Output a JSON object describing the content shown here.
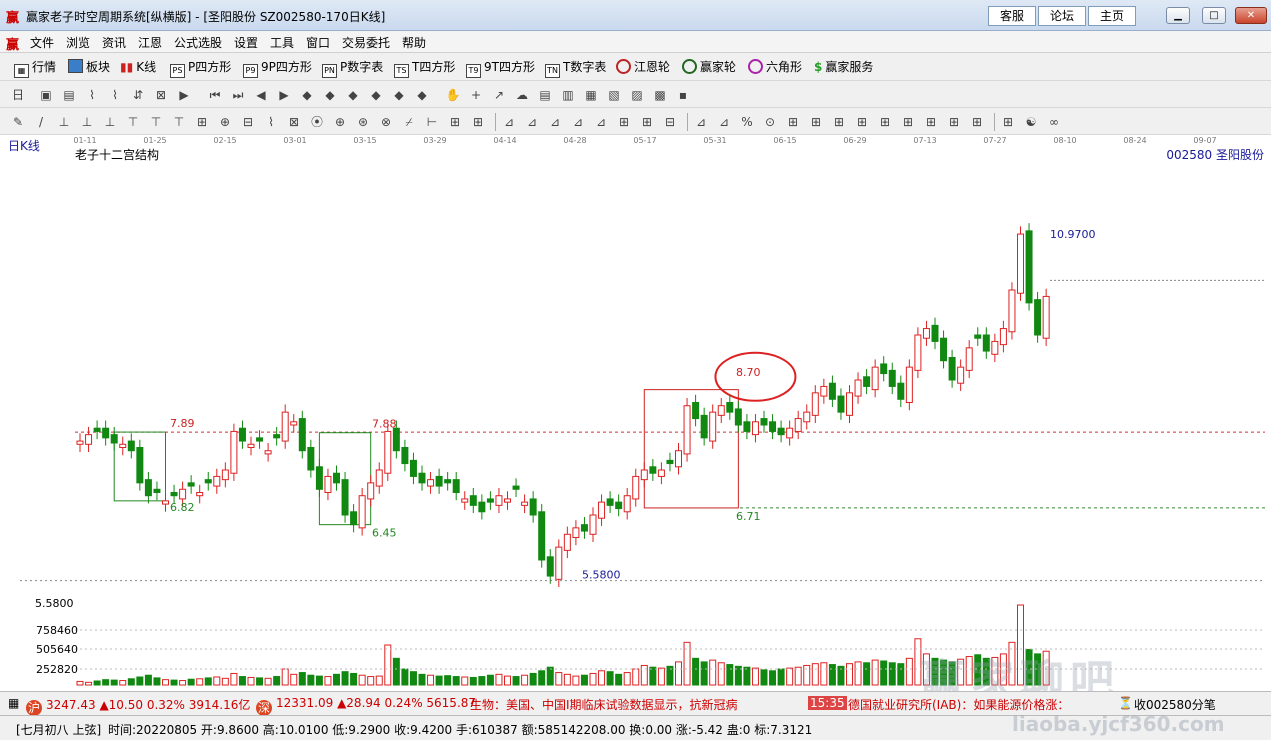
{
  "window": {
    "title": "赢家老子时空周期系统[纵横版] - [圣阳股份  SZ002580-170日K线]",
    "links": [
      "客服",
      "论坛",
      "主页"
    ]
  },
  "menu": [
    "文件",
    "浏览",
    "资讯",
    "江恩",
    "公式选股",
    "设置",
    "工具",
    "窗口",
    "交易委托",
    "帮助"
  ],
  "toolbar1": [
    {
      "icon": "grid-icon",
      "label": "行情"
    },
    {
      "icon": "blocks-icon",
      "label": "板块"
    },
    {
      "icon": "candle-icon",
      "label": "K线"
    },
    {
      "icon": "ps-icon",
      "badge": "PS",
      "label": "P四方形"
    },
    {
      "icon": "p9-icon",
      "badge": "P9",
      "label": "9P四方形"
    },
    {
      "icon": "pn-icon",
      "badge": "PN",
      "label": "P数字表"
    },
    {
      "icon": "ts-icon",
      "badge": "TS",
      "label": "T四方形"
    },
    {
      "icon": "t9-icon",
      "badge": "T9",
      "label": "9T四方形"
    },
    {
      "icon": "tn-icon",
      "badge": "TN",
      "label": "T数字表"
    },
    {
      "icon": "gann-wheel-icon",
      "label": "江恩轮"
    },
    {
      "icon": "winner-wheel-icon",
      "label": "赢家轮"
    },
    {
      "icon": "hexagon-icon",
      "label": "六角形"
    },
    {
      "icon": "dollar-icon",
      "label": "赢家服务"
    }
  ],
  "chart_data": {
    "type": "candlestick",
    "period_label": "日K线",
    "indicator_label": "老子十二宫结构",
    "stock_label": "002580  圣阳股份",
    "date_ticks": [
      "01-11",
      "01-25",
      "02-15",
      "03-01",
      "03-15",
      "03-29",
      "04-14",
      "04-28",
      "05-17",
      "05-31",
      "06-15",
      "06-29",
      "07-13",
      "07-27",
      "08-10",
      "08-24",
      "09-07"
    ],
    "price_labels": [
      {
        "text": "7.89",
        "color": "#cc2222"
      },
      {
        "text": "6.82",
        "color": "#228822"
      },
      {
        "text": "7.88",
        "color": "#cc2222"
      },
      {
        "text": "6.45",
        "color": "#228822"
      },
      {
        "text": "8.70",
        "color": "#cc2222"
      },
      {
        "text": "6.71",
        "color": "#228822"
      },
      {
        "text": "5.5800",
        "color": "#1a1a99"
      },
      {
        "text": "10.9700",
        "color": "#1a1a99"
      }
    ],
    "ref_lines": [
      7.89,
      6.71
    ],
    "y_axis_label": "5.5800",
    "volume_ticks": [
      "758460",
      "505640",
      "252820"
    ],
    "closes": [
      7.75,
      7.85,
      7.9,
      7.8,
      7.72,
      7.7,
      7.6,
      7.1,
      6.9,
      6.95,
      6.82,
      6.9,
      7.0,
      7.05,
      6.95,
      7.1,
      7.2,
      7.3,
      7.9,
      7.75,
      7.7,
      7.75,
      7.6,
      7.8,
      8.2,
      8.05,
      7.6,
      7.3,
      7.0,
      7.2,
      7.1,
      6.6,
      6.45,
      6.9,
      7.1,
      7.3,
      7.9,
      7.6,
      7.4,
      7.2,
      7.1,
      7.15,
      7.05,
      7.1,
      6.95,
      6.85,
      6.75,
      6.65,
      6.8,
      6.9,
      6.85,
      7.0,
      6.8,
      6.6,
      5.9,
      5.65,
      6.1,
      6.3,
      6.4,
      6.35,
      6.6,
      6.8,
      6.75,
      6.7,
      6.9,
      7.2,
      7.3,
      7.25,
      7.3,
      7.4,
      7.6,
      8.3,
      8.1,
      7.8,
      8.2,
      8.3,
      8.2,
      8.0,
      7.9,
      8.05,
      8.0,
      7.9,
      7.85,
      7.95,
      8.1,
      8.2,
      8.5,
      8.6,
      8.4,
      8.2,
      8.5,
      8.7,
      8.6,
      8.9,
      8.8,
      8.6,
      8.4,
      8.9,
      9.4,
      9.5,
      9.3,
      9.0,
      8.7,
      8.9,
      9.2,
      9.35,
      9.15,
      9.3,
      9.5,
      10.1,
      10.97,
      9.9,
      9.4,
      10.0
    ],
    "up_days": [
      0,
      1,
      5,
      10,
      12,
      14,
      16,
      17,
      18,
      20,
      22,
      24,
      25,
      29,
      33,
      34,
      35,
      36,
      41,
      45,
      49,
      50,
      52,
      56,
      57,
      58,
      60,
      61,
      64,
      65,
      66,
      68,
      70,
      71,
      74,
      75,
      79,
      83,
      84,
      85,
      86,
      87,
      90,
      91,
      93,
      97,
      98,
      99,
      103,
      104,
      107,
      108,
      109,
      110,
      113
    ],
    "volumes": [
      40,
      30,
      45,
      60,
      55,
      50,
      70,
      90,
      110,
      80,
      60,
      55,
      50,
      65,
      70,
      80,
      90,
      75,
      130,
      95,
      85,
      80,
      75,
      95,
      180,
      120,
      140,
      110,
      100,
      95,
      120,
      150,
      130,
      110,
      95,
      100,
      450,
      300,
      180,
      150,
      120,
      110,
      100,
      105,
      95,
      90,
      85,
      95,
      110,
      120,
      100,
      95,
      110,
      130,
      160,
      200,
      140,
      120,
      100,
      110,
      130,
      160,
      150,
      120,
      140,
      180,
      220,
      200,
      190,
      210,
      260,
      480,
      300,
      260,
      280,
      250,
      230,
      210,
      200,
      190,
      170,
      160,
      180,
      190,
      200,
      220,
      240,
      250,
      230,
      210,
      240,
      260,
      250,
      280,
      270,
      250,
      240,
      300,
      520,
      350,
      300,
      280,
      260,
      290,
      320,
      340,
      300,
      310,
      350,
      480,
      900,
      400,
      350,
      380
    ]
  },
  "status": {
    "sh_badge": "沪",
    "sh_quote": "3247.43 ▲10.50 0.32% 3914.16亿",
    "sz_badge": "深",
    "sz_quote": "12331.09 ▲28.94 0.24% 5615.87",
    "news1": "生物：美国、中国Ⅰ期临床试验数据显示，抗新冠病",
    "time": "15:35",
    "news2": "德国就业研究所(IAB)：如果能源价格涨：",
    "ticks": "收002580分笔"
  },
  "info": {
    "lunar": "[七月初八  上弦]",
    "detail": "时间:20220805 开:9.8600 高:10.0100 低:9.2900 收:9.4200 手:610387 额:585142208.00 换:0.00 涨:-5.42 蛊:0 标:7.3121"
  },
  "watermark": {
    "brand": "赢家聊吧",
    "url": "liaoba.yjcf360.com"
  }
}
